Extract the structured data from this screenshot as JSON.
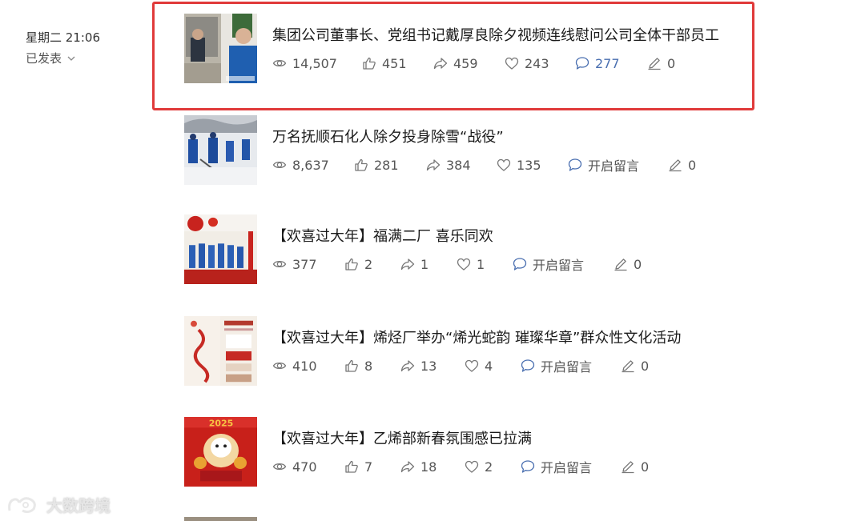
{
  "meta": {
    "datetime": "星期二 21:06",
    "status": "已发表"
  },
  "articles": [
    {
      "title": "集团公司董事长、党组书记戴厚良除夕视频连线慰问公司全体干部员工",
      "views": "14,507",
      "likes": "451",
      "shares": "459",
      "favorites": "243",
      "comments": "277",
      "comments_is_count": true,
      "edits": "0",
      "highlighted": true
    },
    {
      "title": "万名抚顺石化人除夕投身除雪“战役”",
      "views": "8,637",
      "likes": "281",
      "shares": "384",
      "favorites": "135",
      "comments": "开启留言",
      "comments_is_count": false,
      "edits": "0"
    },
    {
      "title": "【欢喜过大年】福满二厂 喜乐同欢",
      "views": "377",
      "likes": "2",
      "shares": "1",
      "favorites": "1",
      "comments": "开启留言",
      "comments_is_count": false,
      "edits": "0"
    },
    {
      "title": "【欢喜过大年】烯烃厂举办“烯光蛇韵  璀璨华章”群众性文化活动",
      "views": "410",
      "likes": "8",
      "shares": "13",
      "favorites": "4",
      "comments": "开启留言",
      "comments_is_count": false,
      "edits": "0"
    },
    {
      "title": "【欢喜过大年】乙烯部新春氛围感已拉满",
      "views": "470",
      "likes": "7",
      "shares": "18",
      "favorites": "2",
      "comments": "开启留言",
      "comments_is_count": false,
      "edits": "0"
    }
  ],
  "watermark": {
    "text": "大数跨境"
  },
  "colors": {
    "highlight": "#e03a3a",
    "link_blue": "#4a6fb0"
  }
}
